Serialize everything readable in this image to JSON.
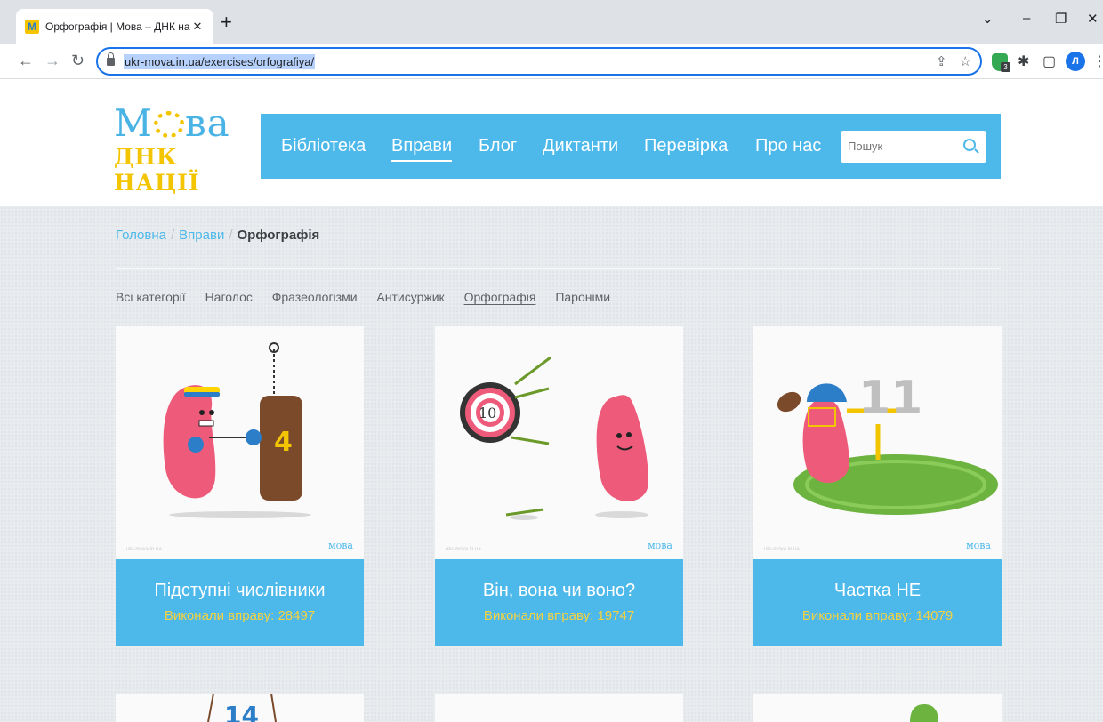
{
  "browser": {
    "tab_title": "Орфографія | Мова – ДНК нації",
    "tab_close": "✕",
    "new_tab": "+",
    "url": "ukr-mova.in.ua/exercises/orfografiya/",
    "controls": {
      "dropdown": "⌄",
      "minimize": "–",
      "restore": "❐",
      "close": "✕"
    },
    "profile_initial": "Л",
    "extension_badge": "3"
  },
  "site": {
    "logo_top": "М",
    "logo_top_end": "ва",
    "logo_bottom": "ДНК НАЦІЇ",
    "nav": [
      "Бібліотека",
      "Вправи",
      "Блог",
      "Диктанти",
      "Перевірка",
      "Про нас"
    ],
    "search_placeholder": "Пошук"
  },
  "breadcrumb": {
    "home": "Головна",
    "section": "Вправи",
    "current": "Орфографія",
    "separator": "/"
  },
  "categories": [
    "Всі категорії",
    "Наголос",
    "Фразеологізми",
    "Антисуржик",
    "Орфографія",
    "Пароніми"
  ],
  "cards": [
    {
      "title": "Підступні числівники",
      "count": "Виконали вправу: 28497",
      "badge": "4"
    },
    {
      "title": "Він, вона чи воно?",
      "count": "Виконали вправу: 19747",
      "badge": "10"
    },
    {
      "title": "Частка НЕ",
      "count": "Виконали вправу: 14079",
      "badge": "11"
    }
  ],
  "watermark_left": "ukr-mova.in.ua",
  "watermark_right": "мова",
  "next_card_badge": "14",
  "colors": {
    "accent": "#4db8ea",
    "count": "#f6d23f",
    "logo_yellow": "#f3c400"
  }
}
